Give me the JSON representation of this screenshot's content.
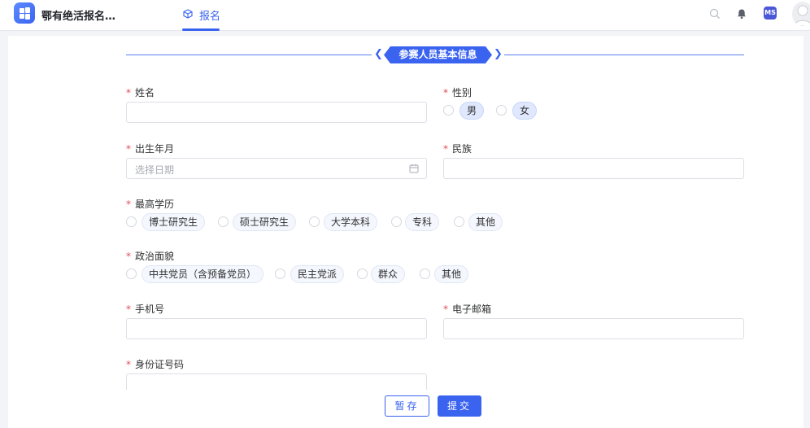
{
  "header": {
    "app_title": "鄂有绝活报名…",
    "nav_tab_label": "报名",
    "ms_badge": "MS"
  },
  "section": {
    "title": "参赛人员基本信息"
  },
  "form": {
    "required_mark": "*",
    "name": {
      "label": "姓名",
      "value": ""
    },
    "gender": {
      "label": "性别",
      "options": [
        "男",
        "女"
      ]
    },
    "birth": {
      "label": "出生年月",
      "placeholder": "选择日期"
    },
    "ethnicity": {
      "label": "民族",
      "value": ""
    },
    "education": {
      "label": "最高学历",
      "options": [
        "博士研究生",
        "硕士研究生",
        "大学本科",
        "专科",
        "其他"
      ]
    },
    "political": {
      "label": "政治面貌",
      "options": [
        "中共党员（含预备党员）",
        "民主党派",
        "群众",
        "其他"
      ]
    },
    "phone": {
      "label": "手机号",
      "value": ""
    },
    "email": {
      "label": "电子邮箱",
      "value": ""
    },
    "id_number": {
      "label": "身份证号码",
      "value": ""
    }
  },
  "footer": {
    "save_label": "暂存",
    "submit_label": "提交"
  },
  "colors": {
    "accent": "#3a63f0",
    "required": "#e34d59"
  },
  "icons": [
    "windows-logo-icon",
    "box-icon",
    "search-icon",
    "bell-icon",
    "ms-badge-icon",
    "avatar",
    "calendar-icon"
  ]
}
